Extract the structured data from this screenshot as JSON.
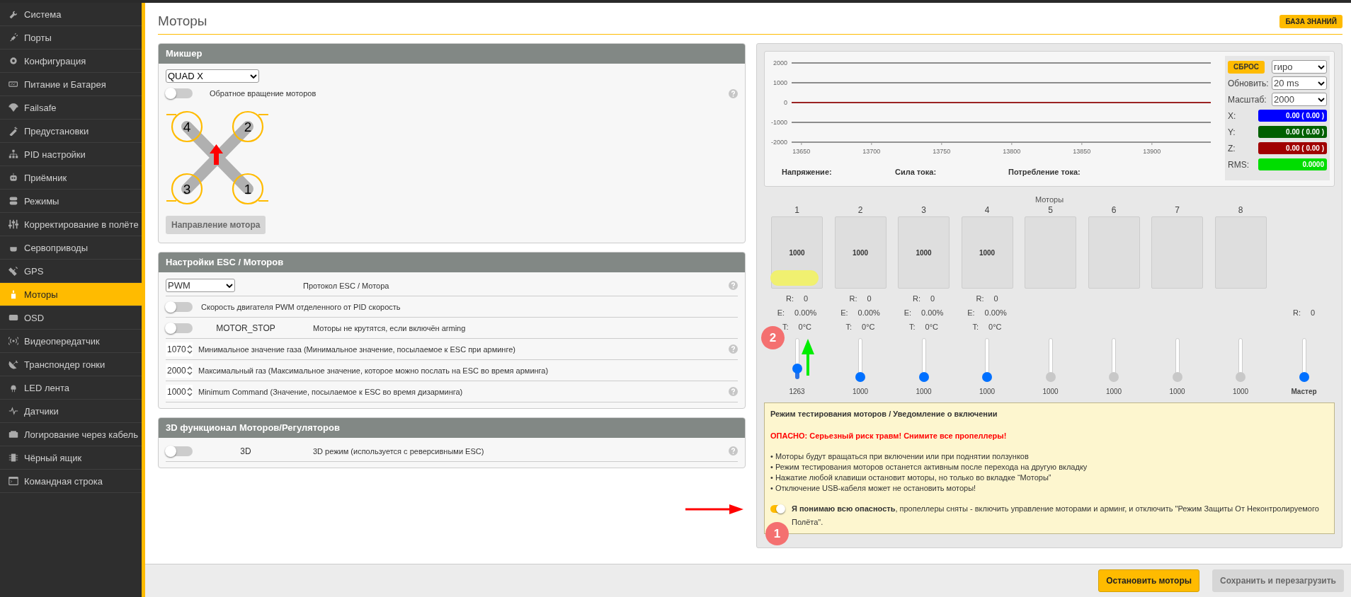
{
  "sidebar": {
    "items": [
      {
        "label": "Система",
        "selected": false
      },
      {
        "label": "Порты",
        "selected": false
      },
      {
        "label": "Конфигурация",
        "selected": false
      },
      {
        "label": "Питание и Батарея",
        "selected": false
      },
      {
        "label": "Failsafe",
        "selected": false
      },
      {
        "label": "Предустановки",
        "selected": false
      },
      {
        "label": "PID настройки",
        "selected": false
      },
      {
        "label": "Приёмник",
        "selected": false
      },
      {
        "label": "Режимы",
        "selected": false
      },
      {
        "label": "Корректирование в полёте",
        "selected": false
      },
      {
        "label": "Сервоприводы",
        "selected": false
      },
      {
        "label": "GPS",
        "selected": false
      },
      {
        "label": "Моторы",
        "selected": true
      },
      {
        "label": "OSD",
        "selected": false
      },
      {
        "label": "Видеопередатчик",
        "selected": false
      },
      {
        "label": "Транспондер гонки",
        "selected": false
      },
      {
        "label": "LED лента",
        "selected": false
      },
      {
        "label": "Датчики",
        "selected": false
      },
      {
        "label": "Логирование через кабель",
        "selected": false
      },
      {
        "label": "Чёрный ящик",
        "selected": false
      },
      {
        "label": "Командная строка",
        "selected": false
      }
    ]
  },
  "page": {
    "title": "Моторы",
    "help_button": "БАЗА ЗНАНИЙ"
  },
  "mixer": {
    "title": "Микшер",
    "mixer_type": "QUAD X",
    "reverse_toggle": {
      "label": "Обратное вращение моторов",
      "on": false
    },
    "help": true,
    "diagram_labels": [
      "4",
      "2",
      "3",
      "1"
    ],
    "direction_button": {
      "label": "Направление мотора",
      "disabled": true
    }
  },
  "esc": {
    "title": "Настройки ESC / Моторов",
    "rows": [
      {
        "kind": "select",
        "value": "PWM",
        "label": "Протокол ESC / Мотора",
        "help": true
      },
      {
        "kind": "toggle",
        "on": false,
        "label": "Скорость двигателя PWM отделенного от PID скорость",
        "help": false
      },
      {
        "kind": "toggle",
        "on": false,
        "name": "MOTOR_STOP",
        "label": "Моторы не крутятся, если включён arming",
        "help": false
      },
      {
        "kind": "number",
        "value": "1070",
        "label": "Минимальное значение газа (Минимальное значение, посылаемое к ESC при арминге)",
        "help": true
      },
      {
        "kind": "number",
        "value": "2000",
        "label": "Максимальный газ (Максимальное значение, которое можно послать на ESC во время арминга)",
        "help": false
      },
      {
        "kind": "number",
        "value": "1000",
        "label": "Minimum Command (Значение, посылаемое к ESC во время дизарминга)",
        "help": true
      }
    ]
  },
  "three_d": {
    "title": "3D функционал Моторов/Регуляторов",
    "rows": [
      {
        "kind": "toggle",
        "on": false,
        "name": "3D",
        "label": "3D режим (используется с реверсивными ESC)",
        "help": true
      }
    ]
  },
  "sensor_graph": {
    "chart_data": {
      "type": "line",
      "x": [
        13643,
        13942
      ],
      "series": [
        {
          "color": "#a00000",
          "values": [
            0,
            0
          ]
        }
      ],
      "grid": true,
      "xlim": [
        13643,
        13942
      ],
      "ylim": [
        -2000,
        2000
      ],
      "xticks": [
        13650,
        13700,
        13750,
        13800,
        13850,
        13900
      ],
      "yticks": [
        -2000,
        -1000,
        0,
        1000,
        2000
      ]
    },
    "reset_button": "СБРОС",
    "sensor": "гиро",
    "refresh_label": "Обновить:",
    "refresh": "20 ms",
    "scale_label": "Масштаб:",
    "scale": "2000",
    "readouts": [
      {
        "label": "X:",
        "value": "0.00 ( 0.00 )",
        "color": "#0000ff"
      },
      {
        "label": "Y:",
        "value": "0.00 ( 0.00 )",
        "color": "#006000"
      },
      {
        "label": "Z:",
        "value": "0.00 ( 0.00 )",
        "color": "#a00000"
      },
      {
        "label": "RMS:",
        "value": "0.0000",
        "color": "#00dd00"
      }
    ],
    "power": [
      "Напряжение:",
      "Сила тока:",
      "Потребление тока:"
    ]
  },
  "motors": {
    "title": "Моторы",
    "items": [
      {
        "number": "1",
        "value": "1000",
        "telemetry": [
          {
            "label": "R:",
            "value": "0"
          },
          {
            "label": "E:",
            "value": "0.00%"
          },
          {
            "label": "T:",
            "value": "0°C"
          }
        ],
        "slider_value": "1263",
        "level": 0.26,
        "enabled": true
      },
      {
        "number": "2",
        "value": "1000",
        "telemetry": [
          {
            "label": "R:",
            "value": "0"
          },
          {
            "label": "E:",
            "value": "0.00%"
          },
          {
            "label": "T:",
            "value": "0°C"
          }
        ],
        "slider_value": "1000",
        "level": 0,
        "enabled": true
      },
      {
        "number": "3",
        "value": "1000",
        "telemetry": [
          {
            "label": "R:",
            "value": "0"
          },
          {
            "label": "E:",
            "value": "0.00%"
          },
          {
            "label": "T:",
            "value": "0°C"
          }
        ],
        "slider_value": "1000",
        "level": 0,
        "enabled": true
      },
      {
        "number": "4",
        "value": "1000",
        "telemetry": [
          {
            "label": "R:",
            "value": "0"
          },
          {
            "label": "E:",
            "value": "0.00%"
          },
          {
            "label": "T:",
            "value": "0°C"
          }
        ],
        "slider_value": "1000",
        "level": 0,
        "enabled": true
      },
      {
        "number": "5",
        "slider_value": "1000",
        "level": 0,
        "enabled": false
      },
      {
        "number": "6",
        "slider_value": "1000",
        "level": 0,
        "enabled": false
      },
      {
        "number": "7",
        "slider_value": "1000",
        "level": 0,
        "enabled": false
      },
      {
        "number": "8",
        "slider_value": "1000",
        "level": 0,
        "enabled": false
      }
    ],
    "master": {
      "label": "Мастер",
      "telemetry": [
        {
          "label": "R:",
          "value": "0"
        }
      ],
      "level": 0,
      "enabled": true
    }
  },
  "warning": {
    "title": "Режим тестирования моторов / Уведомление о включении",
    "danger": "ОПАСНО: Серьезный риск травм! Снимите все пропеллеры!",
    "bullets": [
      "• Моторы будут вращаться при включении или при поднятии ползунков",
      "• Режим тестирования моторов останется активным после перехода на другую вкладку",
      "• Нажатие любой клавиши остановит моторы, но только во вкладке “Моторы”",
      "• Отключение USB-кабеля может не остановить моторы!"
    ],
    "consent": {
      "on": true,
      "text": "**Я понимаю всю опасность**, пропеллеры сняты - включить управление моторами и арминг, и отключить \"Режим Защиты От Неконтролируемого Полёта\"."
    }
  },
  "footer": {
    "buttons": [
      {
        "label": "Остановить моторы",
        "disabled": false
      },
      {
        "label": "Сохранить и перезагрузить",
        "disabled": true
      }
    ]
  },
  "annotations": [
    {
      "kind": "arrow",
      "color": "#ff0000"
    },
    {
      "kind": "badge",
      "label": "1"
    },
    {
      "kind": "badge",
      "label": "2"
    },
    {
      "kind": "arrow",
      "color": "#00ee00"
    },
    {
      "kind": "highlight",
      "color": "#f0f070"
    }
  ]
}
